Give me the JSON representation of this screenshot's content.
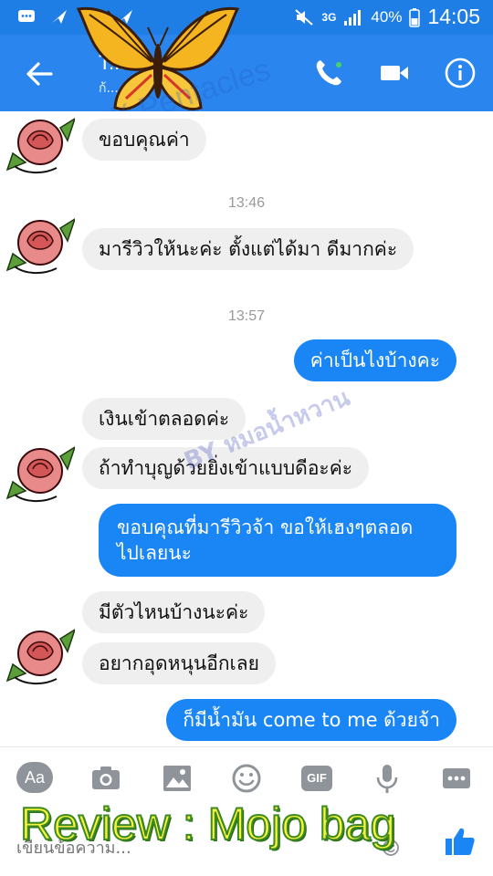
{
  "status_bar": {
    "network": "3G",
    "battery": "40%",
    "time": "14:05"
  },
  "header": {
    "contact_name": "T...in...n",
    "contact_status": "ก้..."
  },
  "watermarks": {
    "brand": "X Pentacles",
    "shop": "BY หมอน้ำหวาน"
  },
  "messages": {
    "m1": "ขอบคุณค่า",
    "ts1": "13:46",
    "m2": "มารีวิวให้นะค่ะ ตั้งแต่ได้มา ดีมากค่ะ",
    "ts2": "13:57",
    "m3": "ค่าเป็นไงบ้างคะ",
    "m4": "เงินเข้าตลอดค่ะ",
    "m5": "ถ้าทำบุญด้วยยิ่งเข้าแบบดีอะค่ะ",
    "m6_line1": "ขอบคุณที่มารีวิวจ้า ขอให้เฮงๆตลอด",
    "m6_line2": "ไปเลยนะ",
    "m7": "มีตัวไหนบ้างนะค่ะ",
    "m8": "อยากอุดหนุนอีกเลย",
    "m9": "ก็มีน้ำมัน come to me ด้วยจ้า"
  },
  "composer": {
    "aa_label": "Aa",
    "gif_label": "GIF",
    "placeholder": "เขียนข้อความ..."
  },
  "overlay_caption": "Review : Mojo bag",
  "colors": {
    "header_blue": "#2a86ee",
    "bubble_out": "#1a86f5",
    "bubble_in": "#efefef",
    "caption_yellow": "#f7f23a",
    "caption_green": "#3d8a25"
  }
}
